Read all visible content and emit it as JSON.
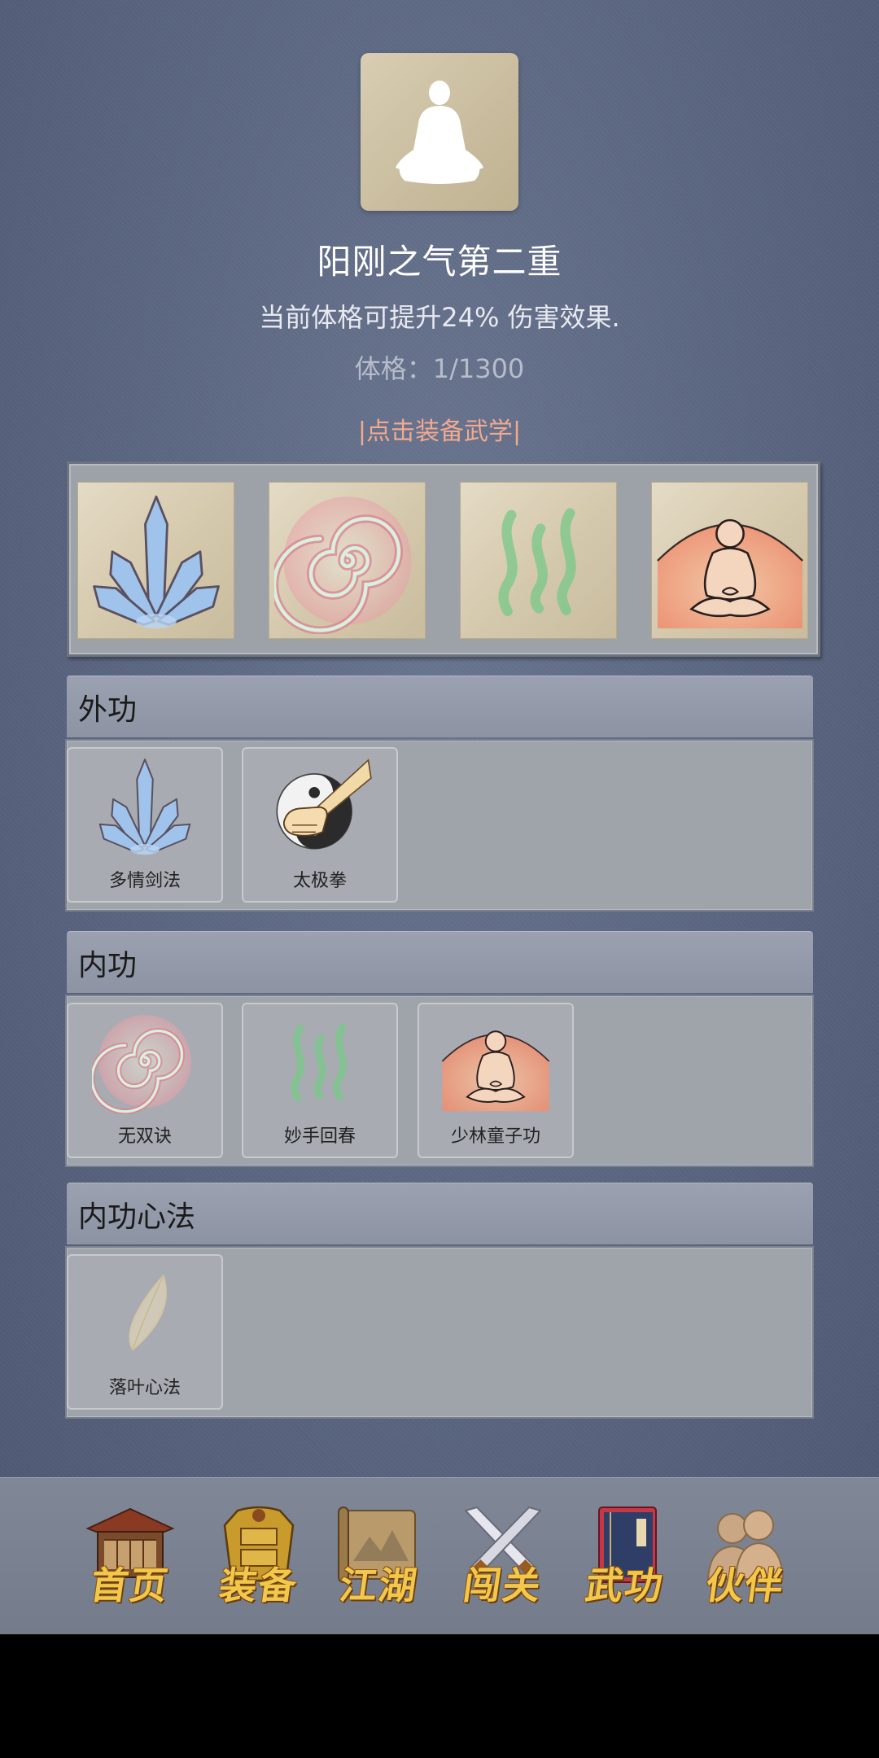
{
  "hero": {
    "title": "阳刚之气第二重",
    "description": "当前体格可提升24% 伤害效果.",
    "stat": "体格：1/1300",
    "equip_hint": "|点击装备武学|"
  },
  "equipped_slots": [
    {
      "icon": "blue-sword-fan-icon"
    },
    {
      "icon": "pink-spiral-icon"
    },
    {
      "icon": "green-waves-icon"
    },
    {
      "icon": "meditating-monk-icon"
    }
  ],
  "sections": {
    "outer": {
      "title": "外功",
      "skills": [
        {
          "name": "多情剑法",
          "icon": "blue-sword-fan-icon"
        },
        {
          "name": "太极拳",
          "icon": "taiji-fist-icon"
        }
      ]
    },
    "inner": {
      "title": "内功",
      "skills": [
        {
          "name": "无双诀",
          "icon": "pink-spiral-icon"
        },
        {
          "name": "妙手回春",
          "icon": "green-waves-icon"
        },
        {
          "name": "少林童子功",
          "icon": "meditating-monk-icon"
        }
      ]
    },
    "mind": {
      "title": "内功心法",
      "skills": [
        {
          "name": "落叶心法",
          "icon": "leaf-icon"
        }
      ]
    }
  },
  "nav": [
    {
      "label": "首页",
      "icon": "house-icon"
    },
    {
      "label": "装备",
      "icon": "armor-icon"
    },
    {
      "label": "江湖",
      "icon": "scroll-map-icon"
    },
    {
      "label": "闯关",
      "icon": "crossed-swords-icon"
    },
    {
      "label": "武功",
      "icon": "book-icon"
    },
    {
      "label": "伙伴",
      "icon": "partners-icon"
    }
  ],
  "colors": {
    "background": "#5c6782",
    "hint": "#f1a98f",
    "nav_text": "#f3c84a"
  }
}
